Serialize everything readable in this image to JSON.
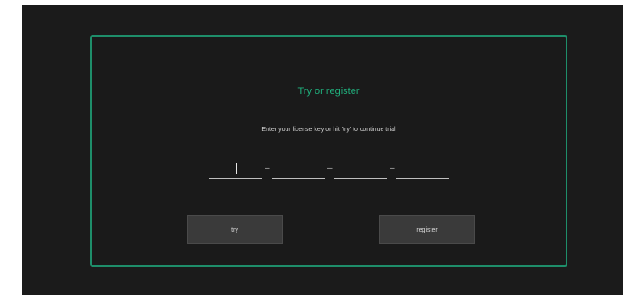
{
  "dialog": {
    "title": "Try or register",
    "instructions": "Enter your license key or hit 'try' to continue trial",
    "key_separator": "–",
    "key_fields": [
      {
        "value": ""
      },
      {
        "value": ""
      },
      {
        "value": ""
      },
      {
        "value": ""
      }
    ],
    "try_label": "try",
    "register_label": "register"
  },
  "colors": {
    "accent": "#20b27e",
    "border": "#1e8e6a",
    "background": "#1b1b1b",
    "button": "#3a3a3a"
  }
}
